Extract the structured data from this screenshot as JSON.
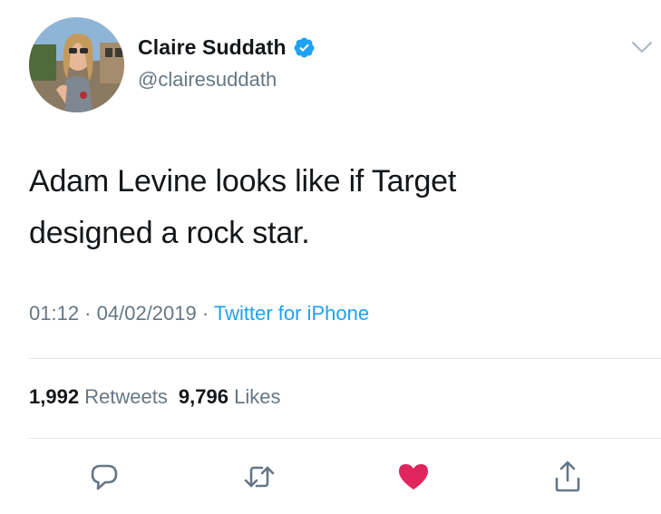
{
  "author": {
    "display_name": "Claire Suddath",
    "handle": "@clairesuddath",
    "verified": true,
    "verified_color": "#1da1f2",
    "avatar_icon": "profile-photo"
  },
  "tweet": {
    "text_line1": "Adam Levine looks like if Target",
    "text_line2": "designed a rock star.",
    "time": "01:12",
    "separator1": " · ",
    "date": "04/02/2019",
    "separator2": " · ",
    "source": "Twitter for iPhone"
  },
  "stats": {
    "retweets_count": "1,992",
    "retweets_label": "Retweets",
    "likes_count": "9,796",
    "likes_label": "Likes"
  },
  "actions": {
    "reply_icon": "reply-icon",
    "retweet_icon": "retweet-icon",
    "like_icon": "heart-icon",
    "like_active": true,
    "like_color": "#e0245e",
    "share_icon": "share-icon"
  },
  "colors": {
    "primary_text": "#14171a",
    "secondary_text": "#657786",
    "link": "#1da1f2",
    "divider": "#e1e8ed"
  }
}
